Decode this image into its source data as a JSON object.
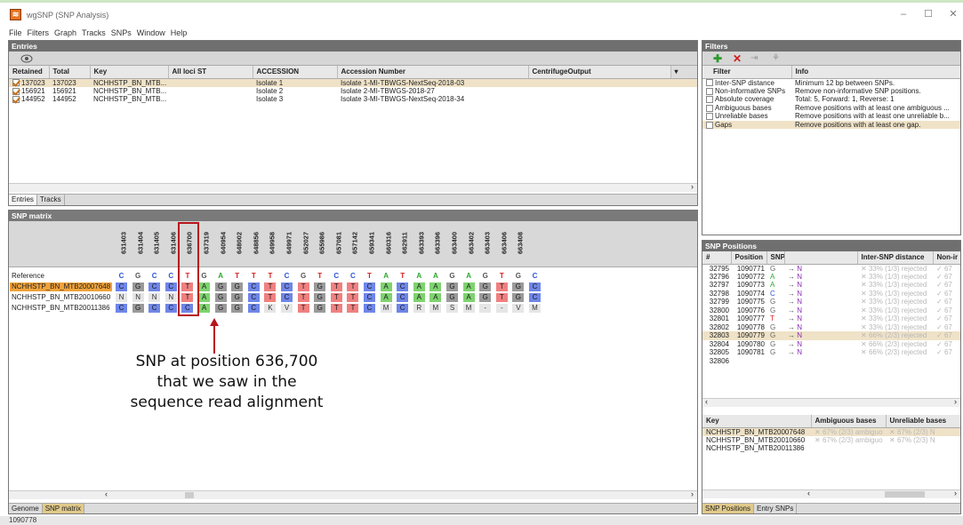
{
  "window": {
    "title": "wgSNP (SNP Analysis)",
    "app_icon": "app-logo-icon",
    "minimize": "–",
    "maximize": "☐",
    "close": "✕"
  },
  "menu": [
    "File",
    "Filters",
    "Graph",
    "Tracks",
    "SNPs",
    "Window",
    "Help"
  ],
  "entries": {
    "header": "Entries",
    "columns": [
      "Retained",
      "Total",
      "Key",
      "All loci ST",
      "ACCESSION",
      "Accession Number",
      "CentrifugeOutput"
    ],
    "rows": [
      {
        "retained": "137023",
        "total": "137023",
        "key": "NCHHSTP_BN_MTB...",
        "st": "",
        "accession": "Isolate 1",
        "accnum": "Isolate 1-MI-TBWGS-NextSeq-2018-03",
        "centrifuge": "",
        "checked": true,
        "selected": true
      },
      {
        "retained": "156921",
        "total": "156921",
        "key": "NCHHSTP_BN_MTB...",
        "st": "",
        "accession": "Isolate 2",
        "accnum": "Isolate 2-MI-TBWGS-2018-27",
        "centrifuge": "",
        "checked": true,
        "selected": false
      },
      {
        "retained": "144952",
        "total": "144952",
        "key": "NCHHSTP_BN_MTB...",
        "st": "",
        "accession": "Isolate 3",
        "accnum": "Isolate 3-MI-TBWGS-NextSeq-2018-34",
        "centrifuge": "",
        "checked": true,
        "selected": false
      }
    ],
    "tabs": [
      "Entries",
      "Tracks"
    ]
  },
  "filters": {
    "header": "Filters",
    "columns": [
      "Filter",
      "Info"
    ],
    "rows": [
      {
        "filter": "Inter-SNP distance",
        "info": "Minimum 12 bp between SNPs."
      },
      {
        "filter": "Non-informative SNPs",
        "info": "Remove non-informative SNP positions."
      },
      {
        "filter": "Absolute coverage",
        "info": "Total: 5, Forward: 1, Reverse: 1"
      },
      {
        "filter": "Ambiguous bases",
        "info": "Remove positions with at least one ambiguous ..."
      },
      {
        "filter": "Unreliable bases",
        "info": "Remove positions with at least one unreliable b..."
      },
      {
        "filter": "Gaps",
        "info": "Remove positions with at least one gap."
      }
    ],
    "selected_row": 5
  },
  "snp_matrix": {
    "header": "SNP matrix",
    "positions": [
      "631403",
      "631404",
      "631405",
      "631406",
      "636700",
      "637319",
      "640954",
      "648002",
      "648856",
      "649958",
      "649971",
      "652027",
      "655986",
      "657081",
      "657142",
      "659341",
      "660316",
      "662911",
      "663393",
      "663396",
      "663400",
      "663402",
      "663403",
      "663406",
      "663408"
    ],
    "highlight_index": 4,
    "rows": [
      {
        "label": "Reference",
        "bases": [
          "C",
          "G",
          "C",
          "C",
          "T",
          "G",
          "A",
          "T",
          "T",
          "T",
          "C",
          "G",
          "T",
          "C",
          "C",
          "T",
          "A",
          "T",
          "A",
          "A",
          "G",
          "A",
          "G",
          "T",
          "G",
          "C"
        ]
      },
      {
        "label": "NCHHSTP_BN_MTB20007648",
        "bases": [
          "C",
          "G",
          "C",
          "C",
          "T",
          "A",
          "G",
          "G",
          "C",
          "T",
          "C",
          "T",
          "G",
          "T",
          "T",
          "C",
          "A",
          "C",
          "A",
          "A",
          "G",
          "A",
          "G",
          "T",
          "G",
          "C"
        ],
        "selected": true
      },
      {
        "label": "NCHHSTP_BN_MTB20010660",
        "bases": [
          "N",
          "N",
          "N",
          "N",
          "T",
          "A",
          "G",
          "G",
          "C",
          "T",
          "C",
          "T",
          "G",
          "T",
          "T",
          "C",
          "A",
          "C",
          "A",
          "A",
          "G",
          "A",
          "G",
          "T",
          "G",
          "C"
        ]
      },
      {
        "label": "NCHHSTP_BN_MTB20011386",
        "bases": [
          "C",
          "G",
          "C",
          "C",
          "C",
          "A",
          "G",
          "G",
          "C",
          "K",
          "V",
          "T",
          "G",
          "T",
          "T",
          "C",
          "M",
          "C",
          "R",
          "M",
          "S",
          "M",
          "-",
          "-",
          "V",
          "M"
        ]
      }
    ],
    "tabs": [
      "Genome",
      "SNP matrix"
    ],
    "annotation": [
      "SNP at position 636,700",
      "that we saw in the",
      "sequence read alignment"
    ]
  },
  "snp_positions": {
    "header": "SNP Positions",
    "columns": [
      "#",
      "Position",
      "SNPs",
      "",
      "Inter-SNP distance",
      "Non-ir"
    ],
    "rows": [
      {
        "n": "32795",
        "pos": "1090771",
        "from": "G",
        "to": "N",
        "dist": "33% (1/3) rejected",
        "ni": "67"
      },
      {
        "n": "32796",
        "pos": "1090772",
        "from": "A",
        "to": "N",
        "dist": "33% (1/3) rejected",
        "ni": "67"
      },
      {
        "n": "32797",
        "pos": "1090773",
        "from": "A",
        "to": "N",
        "dist": "33% (1/3) rejected",
        "ni": "67"
      },
      {
        "n": "32798",
        "pos": "1090774",
        "from": "C",
        "to": "N",
        "dist": "33% (1/3) rejected",
        "ni": "67"
      },
      {
        "n": "32799",
        "pos": "1090775",
        "from": "G",
        "to": "N",
        "dist": "33% (1/3) rejected",
        "ni": "67"
      },
      {
        "n": "32800",
        "pos": "1090776",
        "from": "G",
        "to": "N",
        "dist": "33% (1/3) rejected",
        "ni": "67"
      },
      {
        "n": "32801",
        "pos": "1090777",
        "from": "T",
        "to": "N",
        "dist": "33% (1/3) rejected",
        "ni": "67"
      },
      {
        "n": "32802",
        "pos": "1090778",
        "from": "G",
        "to": "N",
        "dist": "33% (1/3) rejected",
        "ni": "67"
      },
      {
        "n": "32803",
        "pos": "1090779",
        "from": "G",
        "to": "N",
        "dist": "66% (2/3) rejected",
        "ni": "67",
        "selected": true
      },
      {
        "n": "32804",
        "pos": "1090780",
        "from": "G",
        "to": "N",
        "dist": "66% (2/3) rejected",
        "ni": "67"
      },
      {
        "n": "32805",
        "pos": "1090781",
        "from": "G",
        "to": "N",
        "dist": "66% (2/3) rejected",
        "ni": "67"
      },
      {
        "n": "32806",
        "pos": "",
        "from": "",
        "to": "",
        "dist": "",
        "ni": ""
      }
    ],
    "tabs": [
      "SNP Positions",
      "Entry SNPs"
    ]
  },
  "key_table": {
    "columns": [
      "Key",
      "Ambiguous bases",
      "Unreliable bases"
    ],
    "rows": [
      {
        "key": "NCHHSTP_BN_MTB20007648",
        "amb": "67% (2/3) ambiguo",
        "unr": "67% (2/3) N",
        "selected": true
      },
      {
        "key": "NCHHSTP_BN_MTB20010660",
        "amb": "67% (2/3) ambiguo",
        "unr": "67% (2/3) N"
      },
      {
        "key": "NCHHSTP_BN_MTB20011386",
        "amb": "",
        "unr": ""
      }
    ]
  },
  "status": "1090778",
  "colors": {
    "A": "#7ed36f",
    "C": "#6f86e8",
    "G": "#9a9a9a",
    "T": "#f08080",
    "sel_row": "#efe2c7",
    "highlight_box": "#b8141c"
  }
}
